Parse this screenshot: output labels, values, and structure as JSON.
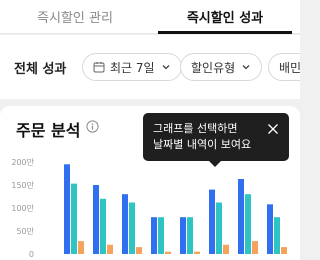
{
  "tabs": [
    {
      "label": "즉시할인 관리",
      "active": false
    },
    {
      "label": "즉시할인 성과",
      "active": true
    }
  ],
  "filters": {
    "title": "전체 성과",
    "period": {
      "label": "최근 7일",
      "icon": "calendar-icon"
    },
    "discount_type": {
      "label": "할인유형"
    },
    "third_chip": {
      "label": "배민"
    }
  },
  "order_analysis": {
    "title": "주문 분석",
    "info_icon": "info-icon"
  },
  "tooltip": {
    "line1": "그래프를 선택하면",
    "line2": "날짜별 내역이 보여요",
    "close_icon": "close-icon"
  },
  "colors": {
    "series1": "#2f6ff0",
    "series2": "#2ec4c4",
    "series3": "#f5a25d",
    "tooltip_bg": "#1f1f1f",
    "active_tab_indicator": "#111111"
  },
  "chart_data": {
    "type": "bar",
    "categories": [
      "",
      "",
      "",
      "",
      "",
      "",
      "",
      ""
    ],
    "series": [
      {
        "values": [
          195,
          150,
          130,
          80,
          80,
          140,
          163,
          108
        ]
      },
      {
        "values": [
          153,
          120,
          112,
          80,
          80,
          112,
          130,
          80
        ]
      },
      {
        "values": [
          28,
          20,
          15,
          5,
          5,
          20,
          28,
          15
        ]
      }
    ],
    "y_ticks": [
      "200만",
      "150만",
      "100만",
      "50만",
      "0"
    ],
    "ylim": [
      0,
      200
    ],
    "unit": "만",
    "grid": false
  }
}
